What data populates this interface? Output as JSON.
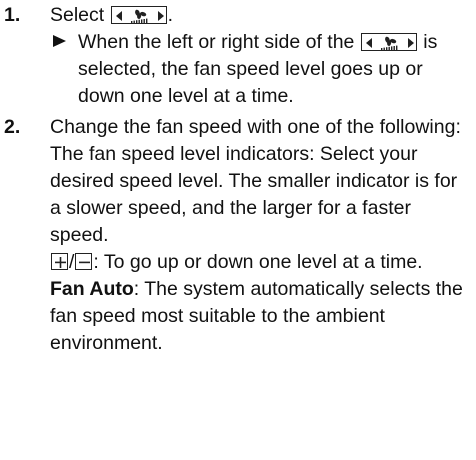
{
  "steps": [
    {
      "number": "1.",
      "text_before": "Select ",
      "text_after": ".",
      "result_part1": "When the left or right side of the ",
      "result_part2": " is selected, the fan speed level goes up or down one level at a time."
    },
    {
      "number": "2.",
      "intro": "Change the fan speed with one of the following:",
      "indicators": "The fan speed level indicators: Select your desired speed level. The smaller indicator is for a slower speed, and the larger for a faster speed.",
      "plusminus_sep": "/",
      "plusminus_text": ": To go up or down one level at a time.",
      "fan_auto_label": "Fan Auto",
      "fan_auto_text": ": The system automatically selects the fan speed most suitable to the ambient environment."
    }
  ],
  "icons": {
    "fan_button": "fan-speed-button-icon",
    "result_arrow": "result-arrow-icon",
    "plus": "plus-button-icon",
    "minus": "minus-button-icon"
  }
}
